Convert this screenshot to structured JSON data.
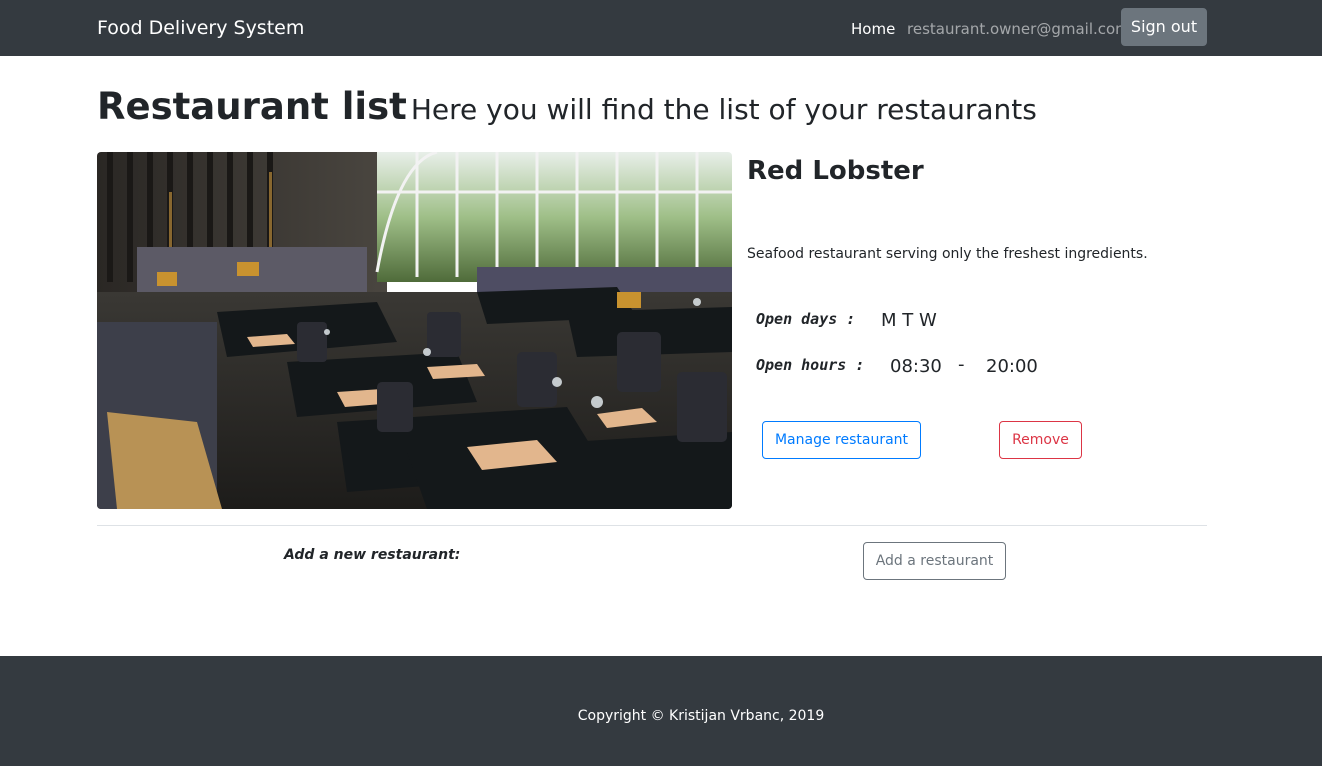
{
  "navbar": {
    "brand": "Food Delivery System",
    "home_link": "Home",
    "user_email": "restaurant.owner@gmail.com",
    "sign_out_label": "Sign out"
  },
  "page": {
    "title": "Restaurant list",
    "subtitle": "Here you will find the list of your restaurants"
  },
  "restaurant": {
    "name": "Red Lobster",
    "description": "Seafood restaurant serving only the freshest ingredients.",
    "open_days_label": "Open days :",
    "open_days_value": "M T W",
    "open_hours_label": "Open hours :",
    "open_from": "08:30",
    "separator": "-",
    "open_to": "20:00",
    "manage_label": "Manage restaurant",
    "remove_label": "Remove",
    "image_alt": "restaurant-interior-photo"
  },
  "add_section": {
    "label": "Add a new restaurant:",
    "button_label": "Add a restaurant"
  },
  "footer": {
    "copyright": "Copyright © Kristijan Vrbanc, 2019"
  },
  "colors": {
    "navbar_bg": "#343a40",
    "primary": "#007bff",
    "danger": "#dc3545",
    "secondary": "#6c757d"
  }
}
